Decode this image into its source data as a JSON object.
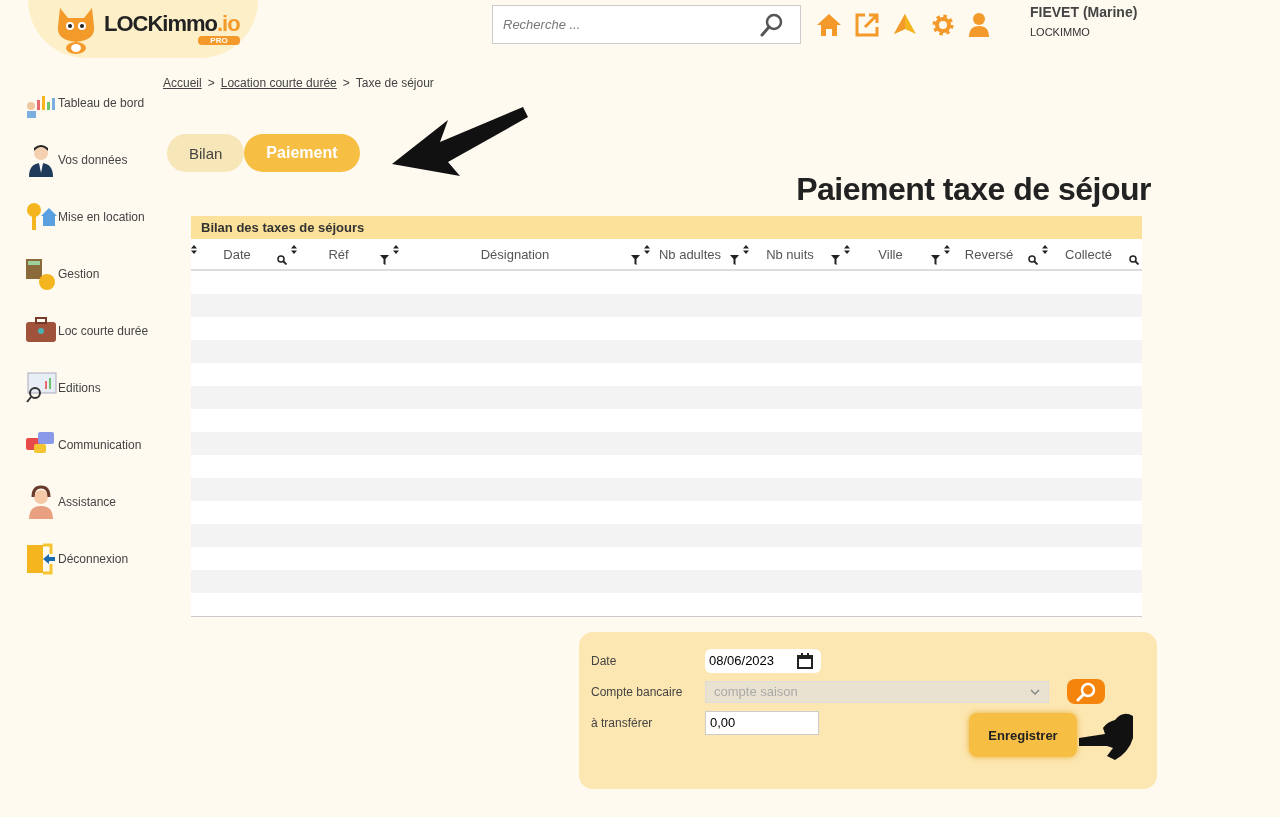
{
  "header": {
    "logo": {
      "name": "LOCKimmo",
      "suffix": ".io",
      "badge": "PRO"
    },
    "search": {
      "placeholder": "Recherche ..."
    },
    "user": {
      "name": "FIEVET (Marine)",
      "company": "LOCKIMMO"
    }
  },
  "sidebar": {
    "items": [
      {
        "label": "Tableau de bord",
        "kind": "dashboard"
      },
      {
        "label": "Vos données",
        "kind": "person"
      },
      {
        "label": "Mise en location",
        "kind": "key"
      },
      {
        "label": "Gestion",
        "kind": "calculator"
      },
      {
        "label": "Loc courte durée",
        "kind": "suitcase"
      },
      {
        "label": "Editions",
        "kind": "monitor"
      },
      {
        "label": "Communication",
        "kind": "chat"
      },
      {
        "label": "Assistance",
        "kind": "headset"
      },
      {
        "label": "Déconnexion",
        "kind": "exit"
      }
    ]
  },
  "breadcrumb": [
    {
      "label": "Accueil",
      "link": true
    },
    {
      "label": "Location courte durée",
      "link": true
    },
    {
      "label": "Taxe de séjour",
      "link": false
    }
  ],
  "breadcrumb_separator": ">",
  "tabs": [
    {
      "label": "Bilan",
      "selected": false
    },
    {
      "label": "Paiement",
      "selected": true
    }
  ],
  "page_title": "Paiement taxe de séjour",
  "table": {
    "title": "Bilan des taxes de séjours",
    "columns": [
      {
        "label": "Date",
        "kind": "search"
      },
      {
        "label": "Réf",
        "kind": "filter"
      },
      {
        "label": "Désignation",
        "kind": "filter"
      },
      {
        "label": "Nb adultes",
        "kind": "filter"
      },
      {
        "label": "Nb nuits",
        "kind": "filter"
      },
      {
        "label": "Ville",
        "kind": "filter"
      },
      {
        "label": "Reversé",
        "kind": "search"
      },
      {
        "label": "Collecté",
        "kind": "search"
      }
    ]
  },
  "form": {
    "date": {
      "label": "Date",
      "value": "08/06/2023"
    },
    "account": {
      "label": "Compte bancaire",
      "value": "compte saison",
      "disabled": true
    },
    "amount": {
      "label": "à transférer",
      "value": "0,00"
    },
    "submit": "Enregistrer"
  }
}
